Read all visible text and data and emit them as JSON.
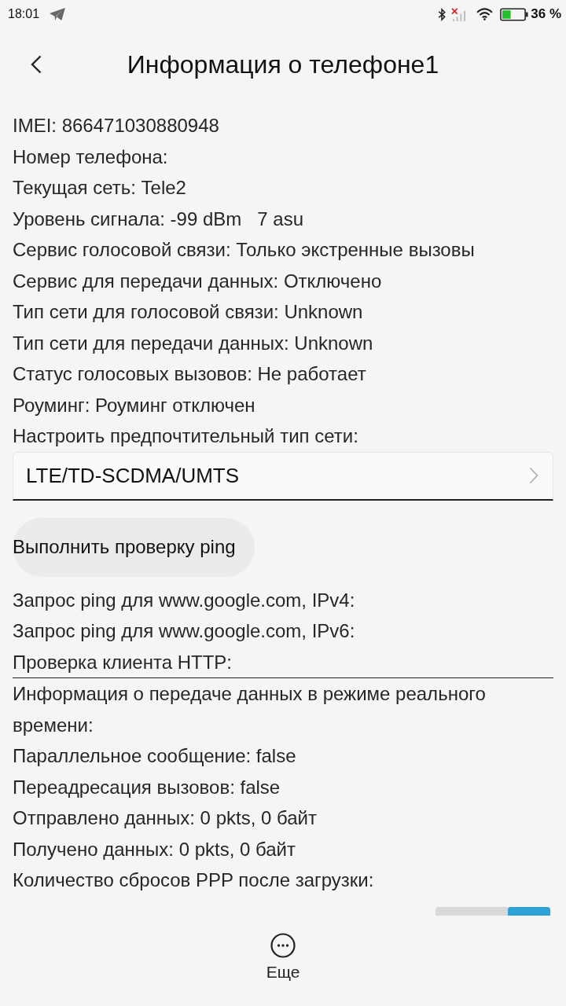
{
  "status_bar": {
    "time": "18:01",
    "battery": "36 %"
  },
  "header": {
    "title": "Информация о телефоне1"
  },
  "info_lines": [
    "IMEI: 866471030880948",
    "Номер телефона:",
    "Текущая сеть: Tele2",
    "Уровень сигнала: -99 dBm   7 asu",
    "Сервис голосовой связи: Только экстренные вызовы",
    "Сервис для передачи данных: Отключено",
    "Тип сети для голосовой связи: Unknown",
    "Тип сети для передачи данных: Unknown",
    "Статус голосовых вызовов: Не работает",
    "Роуминг: Роуминг отключен",
    "Настроить предпочтительный тип сети:"
  ],
  "network_type": {
    "value": "LTE/TD-SCDMA/UMTS"
  },
  "ping_button": {
    "label": "Выполнить проверку ping"
  },
  "ping_lines": [
    "Запрос ping для www.google.com, IPv4:",
    "Запрос ping для www.google.com, IPv6:",
    "Проверка клиента HTTP:"
  ],
  "data_lines": [
    "Информация о передаче данных в режиме реального времени:",
    "Параллельное сообщение: false",
    "Переадресация вызовов: false",
    "Отправлено данных: 0 pkts, 0 байт",
    "Получено данных: 0 pkts, 0 байт",
    "Количество сбросов PPP после загрузки:"
  ],
  "partial_switch": {
    "on": true
  },
  "bottom_bar": {
    "more_label": "Еще"
  }
}
